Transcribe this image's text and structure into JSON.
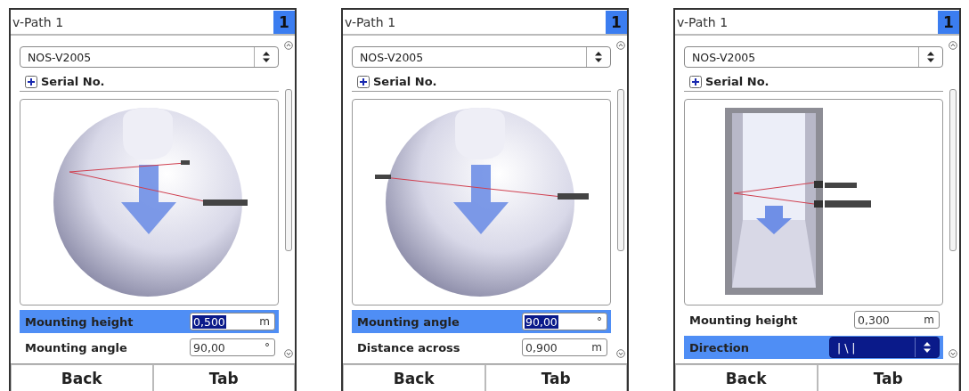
{
  "screens": [
    {
      "title": "v-Path 1",
      "badge": "1",
      "sensor": "NOS-V2005",
      "group": {
        "label": "Serial No.",
        "expanded": false
      },
      "view": {
        "kind": "pipe"
      },
      "rows": [
        {
          "kind": "input",
          "label": "Mounting height",
          "value": "0,500",
          "unit": "m",
          "selected": true
        },
        {
          "kind": "input",
          "label": "Mounting angle",
          "value": "90,00",
          "unit": "°",
          "selected": false
        }
      ],
      "buttons": [
        "Back",
        "Tab"
      ]
    },
    {
      "title": "v-Path 1",
      "badge": "1",
      "sensor": "NOS-V2005",
      "group": {
        "label": "Serial No.",
        "expanded": false
      },
      "view": {
        "kind": "pipe-across"
      },
      "rows": [
        {
          "kind": "input",
          "label": "Mounting angle",
          "value": "90,00",
          "unit": "°",
          "selected": true
        },
        {
          "kind": "input",
          "label": "Distance across",
          "value": "0,900",
          "unit": "m",
          "selected": false
        }
      ],
      "buttons": [
        "Back",
        "Tab"
      ]
    },
    {
      "title": "v-Path 1",
      "badge": "1",
      "sensor": "NOS-V2005",
      "group": {
        "label": "Serial No.",
        "expanded": false
      },
      "view": {
        "kind": "channel"
      },
      "rows": [
        {
          "kind": "input",
          "label": "Mounting height",
          "value": "0,300",
          "unit": "m",
          "selected": false
        },
        {
          "kind": "select",
          "label": "Direction",
          "value": "| \\ |",
          "unit": "",
          "selected": true
        }
      ],
      "buttons": [
        "Back",
        "Tab"
      ]
    }
  ]
}
